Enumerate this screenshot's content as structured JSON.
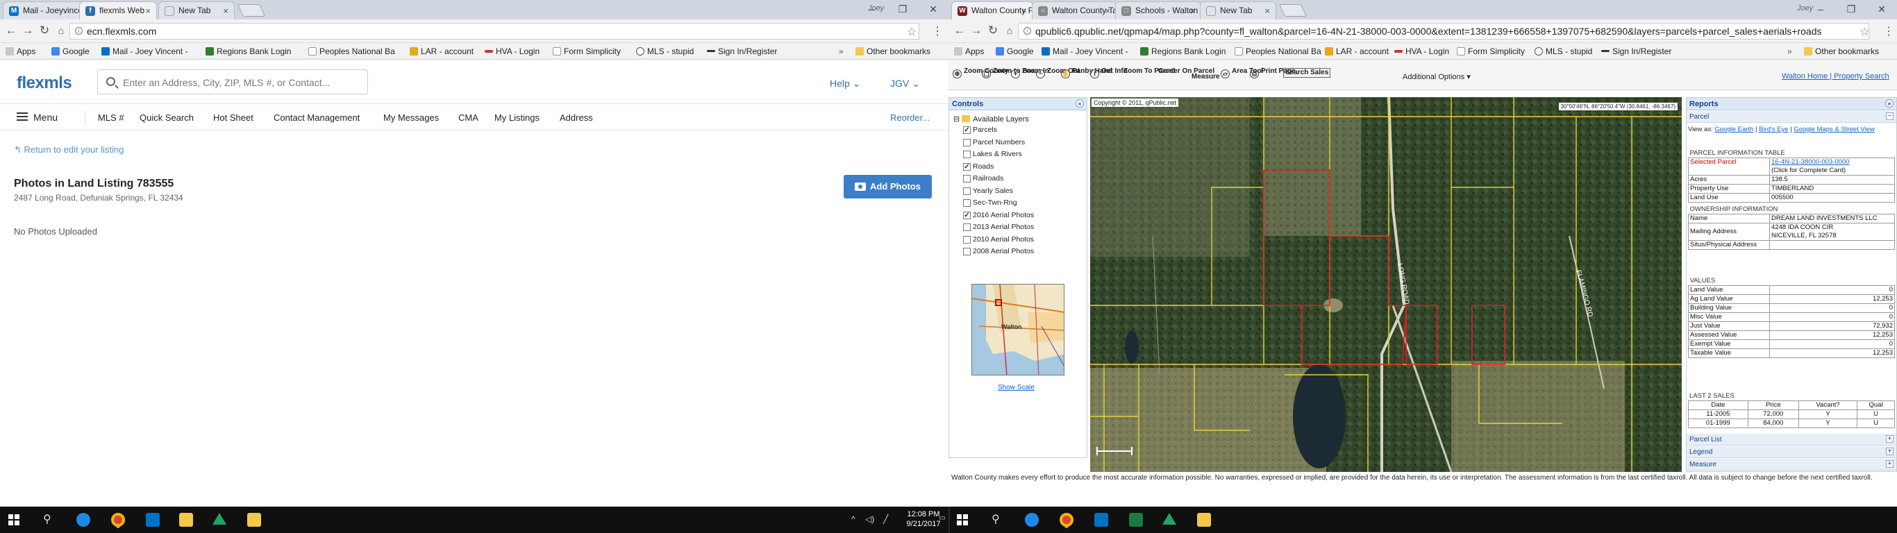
{
  "left": {
    "tabs": [
      {
        "title": "Mail - Joeyvincentpro@...",
        "icon_color": "#0072c6",
        "icon_glyph": "M"
      },
      {
        "title": "flexmls Web",
        "icon_color": "#2d6fb3",
        "icon_glyph": "f"
      },
      {
        "title": "New Tab",
        "icon_color": "",
        "icon_glyph": ""
      }
    ],
    "profile": "Joey",
    "url": "ecn.flexmls.com",
    "bookmarks": [
      "Apps",
      "Google",
      "Mail - Joey Vincent -",
      "Regions Bank Login",
      "Peoples National Ba",
      "LAR - account",
      "HVA - Login",
      "Form Simplicity",
      "MLS - stupid",
      "Sign In/Register"
    ],
    "other_bookmarks": "Other bookmarks",
    "flexmls": {
      "logo": "flexmls",
      "search_placeholder": "Enter an Address, City, ZIP, MLS #, or Contact...",
      "help": "Help",
      "user": "JGV",
      "menu_label": "Menu",
      "nav": [
        "MLS #",
        "Quick Search",
        "Hot Sheet",
        "Contact Management",
        "My Messages",
        "CMA",
        "My Listings",
        "Address"
      ],
      "reorder": "Reorder...",
      "return_link": "Return to edit your listing",
      "title": "Photos in Land Listing 783555",
      "address": "2487 Long Road, Defuniak Springs, FL 32434",
      "add_photos": "Add Photos",
      "no_photos": "No Photos Uploaded"
    }
  },
  "right": {
    "tabs": [
      {
        "title": "Walton County Parcel M...",
        "icon_color": "#7a1f1f",
        "icon_glyph": "W"
      },
      {
        "title": "Walton County Tax Colle...",
        "icon_color": "#888888",
        "icon_glyph": "○"
      },
      {
        "title": "Schools - Walton County ...",
        "icon_color": "#888888",
        "icon_glyph": "□"
      },
      {
        "title": "New Tab",
        "icon_color": "",
        "icon_glyph": ""
      }
    ],
    "profile": "Joey",
    "url": "qpublic6.qpublic.net/qpmap4/map.php?county=fl_walton&parcel=16-4N-21-38000-003-0000&extent=1381239+666558+1397075+682590&layers=parcels+parcel_sales+aerials+roads",
    "bookmarks": [
      "Apps",
      "Google",
      "Mail - Joey Vincent -",
      "Regions Bank Login",
      "Peoples National Ba",
      "LAR - account",
      "HVA - Login",
      "Form Simplicity",
      "MLS - stupid",
      "Sign In/Register"
    ],
    "other_bookmarks": "Other bookmarks",
    "qpublic": {
      "tools": [
        "Zoom County",
        "Zoom to Box",
        "Zoom In",
        "Zoom Out",
        "Panby Hand",
        "Get Info",
        "Zoom To Parcel",
        "Center On Parcel",
        "Measure",
        "Area Tool",
        "Print Page",
        "Search Sales"
      ],
      "additional": "Additional Options",
      "top_links": "Walton Home | Property Search",
      "controls_title": "Controls",
      "layers_title": "Available Layers",
      "layers": [
        {
          "name": "Parcels",
          "checked": true
        },
        {
          "name": "Parcel Numbers",
          "checked": false
        },
        {
          "name": "Lakes & Rivers",
          "checked": false
        },
        {
          "name": "Roads",
          "checked": true
        },
        {
          "name": "Railroads",
          "checked": false
        },
        {
          "name": "Yearly Sales",
          "checked": false
        },
        {
          "name": "Sec-Twn-Rng",
          "checked": false
        },
        {
          "name": "2016 Aerial Photos",
          "checked": true
        },
        {
          "name": "2013 Aerial Photos",
          "checked": false
        },
        {
          "name": "2010 Aerial Photos",
          "checked": false
        },
        {
          "name": "2008 Aerial Photos",
          "checked": false
        }
      ],
      "mini_label": "Walton",
      "show_scale": "Show Scale",
      "map_copyright": "Copyright © 2011, qPublic.net",
      "map_coord": "30°50'46\"N, 86°20'50.4\"W (30.8461, -86.3467)",
      "reports_title": "Reports",
      "parcel_title": "Parcel",
      "view_as_prefix": "View as:",
      "view_as_links": [
        "Google Earth",
        "Bird's Eye",
        "Google Maps & Street View"
      ],
      "parcel_info_title": "PARCEL INFORMATION TABLE",
      "selected_parcel_label": "Selected Parcel",
      "selected_parcel": "16-4N-21-38000-003-0000",
      "click_card": "(Click for Complete Card)",
      "acres_label": "Acres",
      "acres": "138.5",
      "property_use_label": "Property Use",
      "property_use": "TIMBERLAND",
      "land_use_label": "Land Use",
      "land_use": "005500",
      "ownership_title": "OWNERSHIP INFORMATION",
      "name_label": "Name",
      "name": "DREAM LAND INVESTMENTS LLC",
      "mailing_label": "Mailing Address",
      "mailing_1": "4248 IDA COON CIR",
      "mailing_2": "NICEVILLE, FL 32578",
      "situs_label": "Situs/Physical Address",
      "situs": "",
      "values_title": "VALUES",
      "values": [
        {
          "label": "Land Value",
          "value": "0"
        },
        {
          "label": "Ag Land Value",
          "value": "12,253"
        },
        {
          "label": "Building Value",
          "value": "0"
        },
        {
          "label": "Misc Value",
          "value": "0"
        },
        {
          "label": "Just Value",
          "value": "72,932"
        },
        {
          "label": "Assessed Value",
          "value": "12,253"
        },
        {
          "label": "Exempt Value",
          "value": "0"
        },
        {
          "label": "Taxable Value",
          "value": "12,253"
        }
      ],
      "sales_title": "LAST 2 SALES",
      "sales_headers": [
        "Date",
        "Price",
        "Vacant?",
        "Qual"
      ],
      "sales": [
        {
          "date": "11-2005",
          "price": "72,000",
          "vacant": "Y",
          "qual": "U"
        },
        {
          "date": "01-1999",
          "price": "84,000",
          "vacant": "Y",
          "qual": "U"
        }
      ],
      "panels": [
        "Parcel List",
        "Legend",
        "Measure"
      ],
      "footer": "Walton County makes every effort to produce the most accurate information possible. No warranties, expressed or implied, are provided for the data herein, its use or interpretation. The assessment information is from the last certified taxroll. All data is subject to change before the next certified taxroll."
    }
  },
  "taskbar": {
    "time": "12:08 PM",
    "date": "9/21/2017"
  }
}
